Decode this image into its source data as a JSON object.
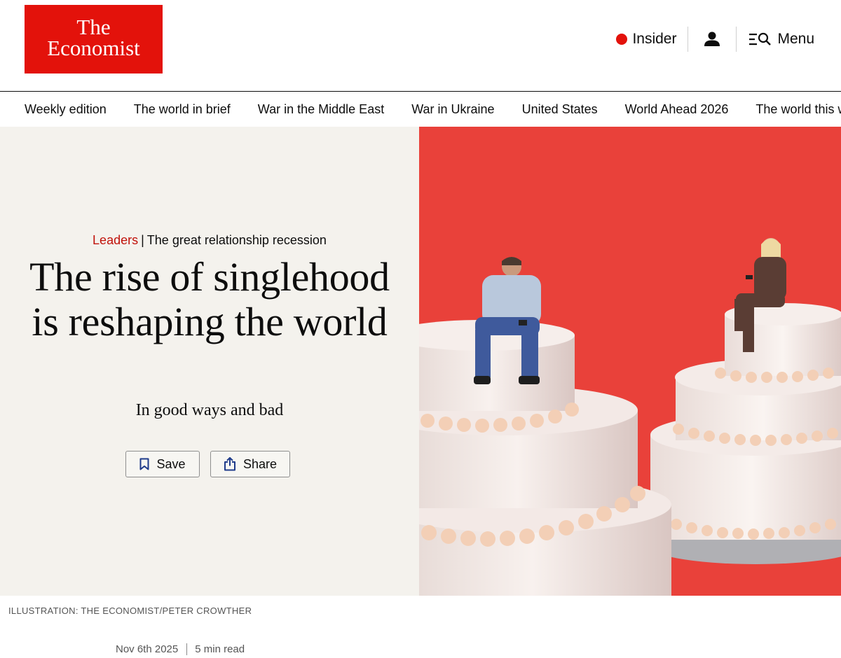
{
  "header": {
    "logo_line1": "The",
    "logo_line2": "Economist",
    "insider_label": "Insider",
    "menu_label": "Menu"
  },
  "nav": {
    "items": [
      "Weekly edition",
      "The world in brief",
      "War in the Middle East",
      "War in Ukraine",
      "United States",
      "World Ahead 2026",
      "The world this week"
    ]
  },
  "article": {
    "section": "Leaders",
    "flytitle": "The great relationship recession",
    "headline": "The rise of singlehood is reshaping the world",
    "rubric": "In good ways and bad",
    "save_label": "Save",
    "share_label": "Share",
    "image_credit": "ILLUSTRATION: THE ECONOMIST/PETER CROWTHER",
    "date": "Nov 6th 2025",
    "read_time": "5 min read"
  },
  "colors": {
    "brand_red": "#e3120b",
    "hero_background": "#e9413a",
    "left_panel": "#f4f2ed",
    "section_label": "#c0120a"
  }
}
